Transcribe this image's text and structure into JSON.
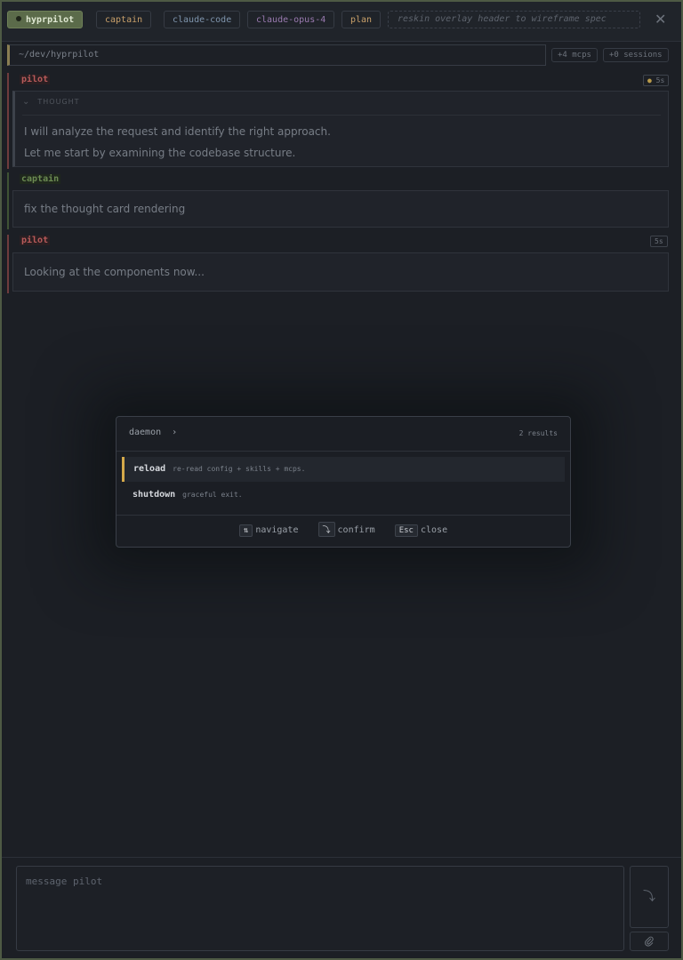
{
  "header": {
    "brand_label": "hyprpilot",
    "chips": [
      {
        "label": "captain"
      },
      {
        "label": "claude-code"
      },
      {
        "label": "claude-opus-4"
      },
      {
        "label": "plan"
      }
    ],
    "task_placeholder": "reskin overlay header to wireframe spec",
    "close_icon": "✕"
  },
  "status_bar": {
    "cwd": "~/dev/hyprpilot",
    "mcps": "+4 mcps",
    "sessions": "+0 sessions"
  },
  "conversation": [
    {
      "role": "pilot",
      "time": "5s",
      "thought_label": "THOUGHT",
      "lines": [
        "I will analyze the request and identify the right approach.",
        "Let me start by examining the codebase structure."
      ]
    },
    {
      "role": "captain",
      "text": "fix the thought card rendering"
    },
    {
      "role": "pilot",
      "time": "5s",
      "text": "Looking at the components now..."
    }
  ],
  "palette": {
    "breadcrumb": "daemon",
    "breadcrumb_chevron": "›",
    "result_count": "2 results",
    "items": [
      {
        "command": "reload",
        "description": "re-read config + skills + mcps."
      },
      {
        "command": "shutdown",
        "description": "graceful exit."
      }
    ],
    "footer": {
      "navigate_key": "⇅",
      "navigate_label": "navigate",
      "confirm_key": "⤵",
      "confirm_label": "confirm",
      "close_key": "Esc",
      "close_label": "close"
    }
  },
  "composer": {
    "placeholder": "message pilot",
    "send_icon": "⤵",
    "attach_icon": "📎"
  },
  "colors": {
    "accent_brand": "#5b6b4a",
    "pilot": "#b85a5a",
    "captain": "#6b8a52",
    "selection": "#d4a94a"
  }
}
